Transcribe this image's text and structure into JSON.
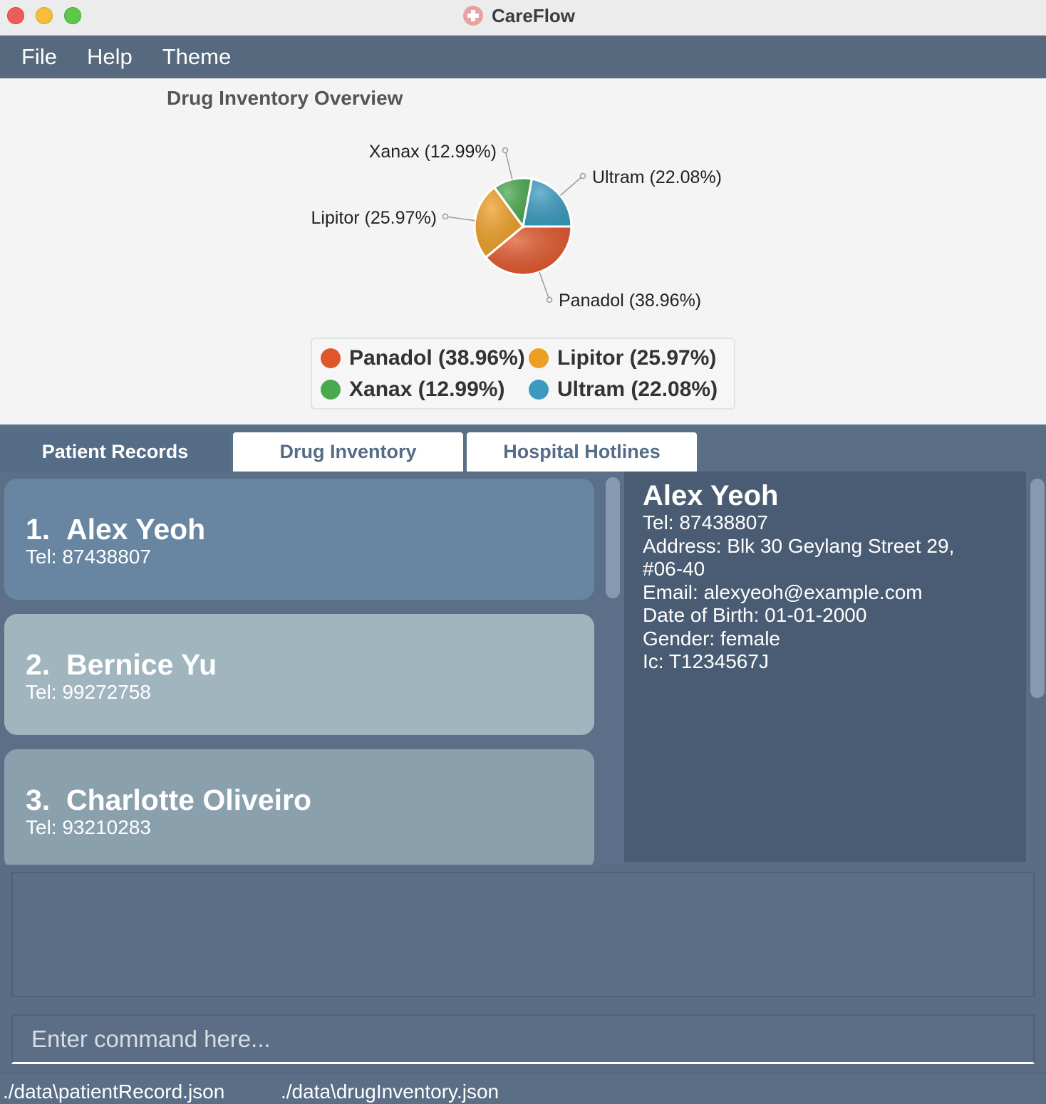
{
  "window": {
    "title": "CareFlow"
  },
  "menu": [
    "File",
    "Help",
    "Theme"
  ],
  "chart_data": {
    "type": "pie",
    "title": "Drug Inventory Overview",
    "slices": [
      {
        "name": "Panadol",
        "percent": 38.96,
        "label": "Panadol (38.96%)",
        "color": "#e0562a"
      },
      {
        "name": "Lipitor",
        "percent": 25.97,
        "label": "Lipitor (25.97%)",
        "color": "#ee9e23"
      },
      {
        "name": "Xanax",
        "percent": 12.99,
        "label": "Xanax (12.99%)",
        "color": "#4aa84f"
      },
      {
        "name": "Ultram",
        "percent": 22.08,
        "label": "Ultram (22.08%)",
        "color": "#3a9bbf"
      }
    ],
    "legend_placement": "bottom"
  },
  "tabs": [
    "Patient Records",
    "Drug Inventory",
    "Hospital Hotlines"
  ],
  "active_tab": "Patient Records",
  "patients": [
    {
      "index": "1.",
      "name": "Alex Yeoh",
      "tel": "Tel: 87438807"
    },
    {
      "index": "2.",
      "name": "Bernice Yu",
      "tel": "Tel: 99272758"
    },
    {
      "index": "3.",
      "name": "Charlotte Oliveiro",
      "tel": "Tel: 93210283"
    }
  ],
  "detail": {
    "name": "Alex Yeoh",
    "tel": "Tel: 87438807",
    "address_line1": "Address: Blk 30 Geylang Street 29,",
    "address_line2": "#06-40",
    "email": "Email: alexyeoh@example.com",
    "dob": "Date of Birth: 01-01-2000",
    "gender": "Gender: female",
    "ic": "Ic: T1234567J"
  },
  "result": "",
  "command": {
    "value": "",
    "placeholder": "Enter command here..."
  },
  "status": {
    "patient_file": "./data\\patientRecord.json",
    "drug_file": "./data\\drugInventory.json"
  }
}
